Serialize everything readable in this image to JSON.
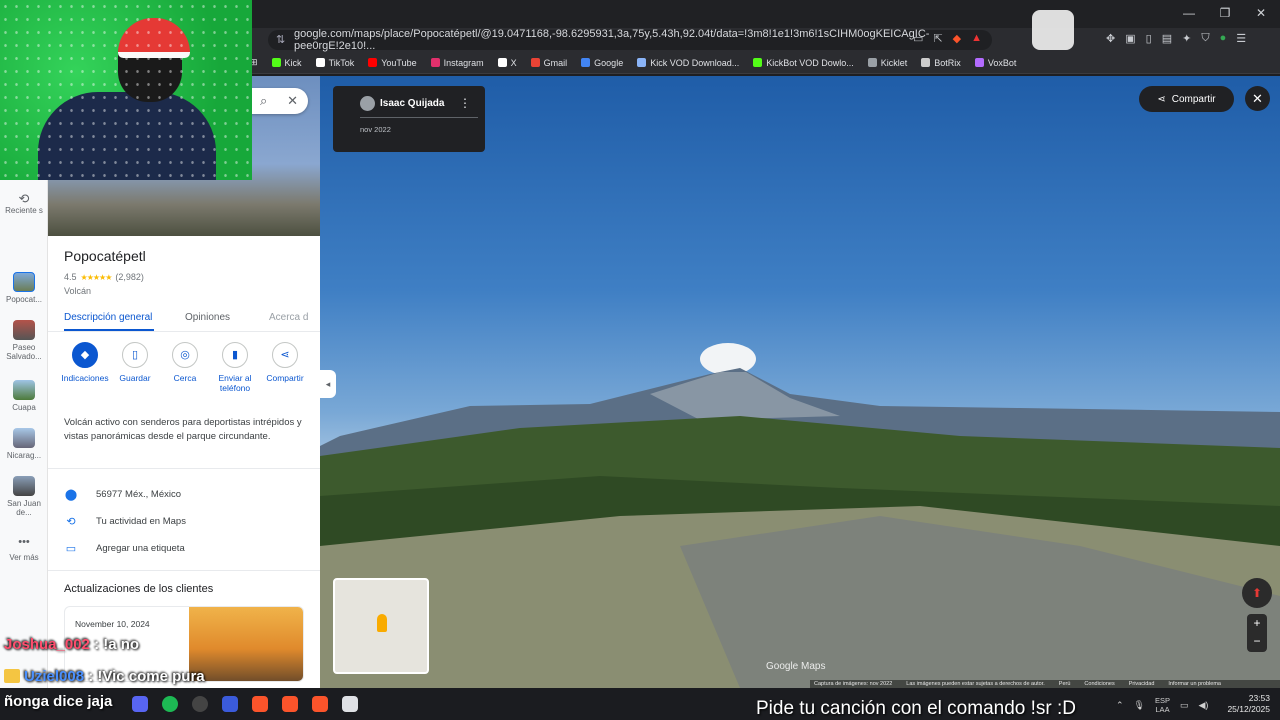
{
  "browser": {
    "url": "google.com/maps/place/Popocatépetl/@19.0471168,-98.6295931,3a,75y,5.43h,92.04t/data=!3m8!1e1!3m6!1sCIHM0ogKEICAgIC-pee0rgE!2e10!...",
    "bookmarks": [
      "Kick",
      "TikTok",
      "YouTube",
      "Instagram",
      "X",
      "Gmail",
      "Google",
      "Kick VOD Download...",
      "KickBot VOD Dowlo...",
      "Kicklet",
      "BotRix",
      "VoxBot"
    ],
    "bookmark_colors": [
      "#53fc18",
      "#ffffff",
      "#ff0000",
      "#e1306c",
      "#ffffff",
      "#ea4335",
      "#4285f4",
      "#8ab4f8",
      "#53fc18",
      "#9aa0a6",
      "#cccccc",
      "#b36bff"
    ]
  },
  "rail": {
    "items": [
      {
        "label": "Reciente s",
        "icon": "history-icon"
      },
      {
        "label": "Popocat...",
        "icon": "place-thumb"
      },
      {
        "label": "Paseo Salvado...",
        "icon": "place-thumb"
      },
      {
        "label": "Cuapa",
        "icon": "place-thumb"
      },
      {
        "label": "Nicarag...",
        "icon": "place-thumb"
      },
      {
        "label": "San Juan de...",
        "icon": "place-thumb"
      },
      {
        "label": "Ver más",
        "icon": "more-icon"
      }
    ]
  },
  "place": {
    "name": "Popocatépetl",
    "rating": "4.5",
    "stars": "★★★★★",
    "reviews": "(2,982)",
    "category": "Volcán",
    "tabs": [
      "Descripción general",
      "Opiniones",
      "Acerca d"
    ],
    "actions": [
      "Indicaciones",
      "Guardar",
      "Cerca",
      "Enviar al teléfono",
      "Compartir"
    ],
    "description": "Volcán activo con senderos para deportistas intrépidos y vistas panorámicas desde el parque circundante.",
    "address": "56977 Méx., México",
    "activity": "Tu actividad en Maps",
    "label_action": "Agregar una etiqueta",
    "updates_title": "Actualizaciones de los clientes",
    "update_date": "November 10, 2024"
  },
  "streetview": {
    "author": "Isaac Quijada",
    "date": "nov 2022",
    "share": "Compartir",
    "watermark": "Google Maps",
    "footer": [
      "Captura de imágenes: nov 2022",
      "Las imágenes pueden estar sujetas a derechos de autor.",
      "Perú",
      "Condiciones",
      "Privacidad",
      "Informar un problema"
    ]
  },
  "chat": {
    "user1": "Joshua_002",
    "msg1": ": !a no",
    "user2": "Uziel008",
    "msg2": ": !Vic come pura",
    "tail": "ñonga dice jaja"
  },
  "banner": "Pide tu canción con el comando !sr :D",
  "taskbar": {
    "lang_top": "ESP",
    "lang_bottom": "LAA",
    "time": "23:53",
    "date": "25/12/2025"
  }
}
